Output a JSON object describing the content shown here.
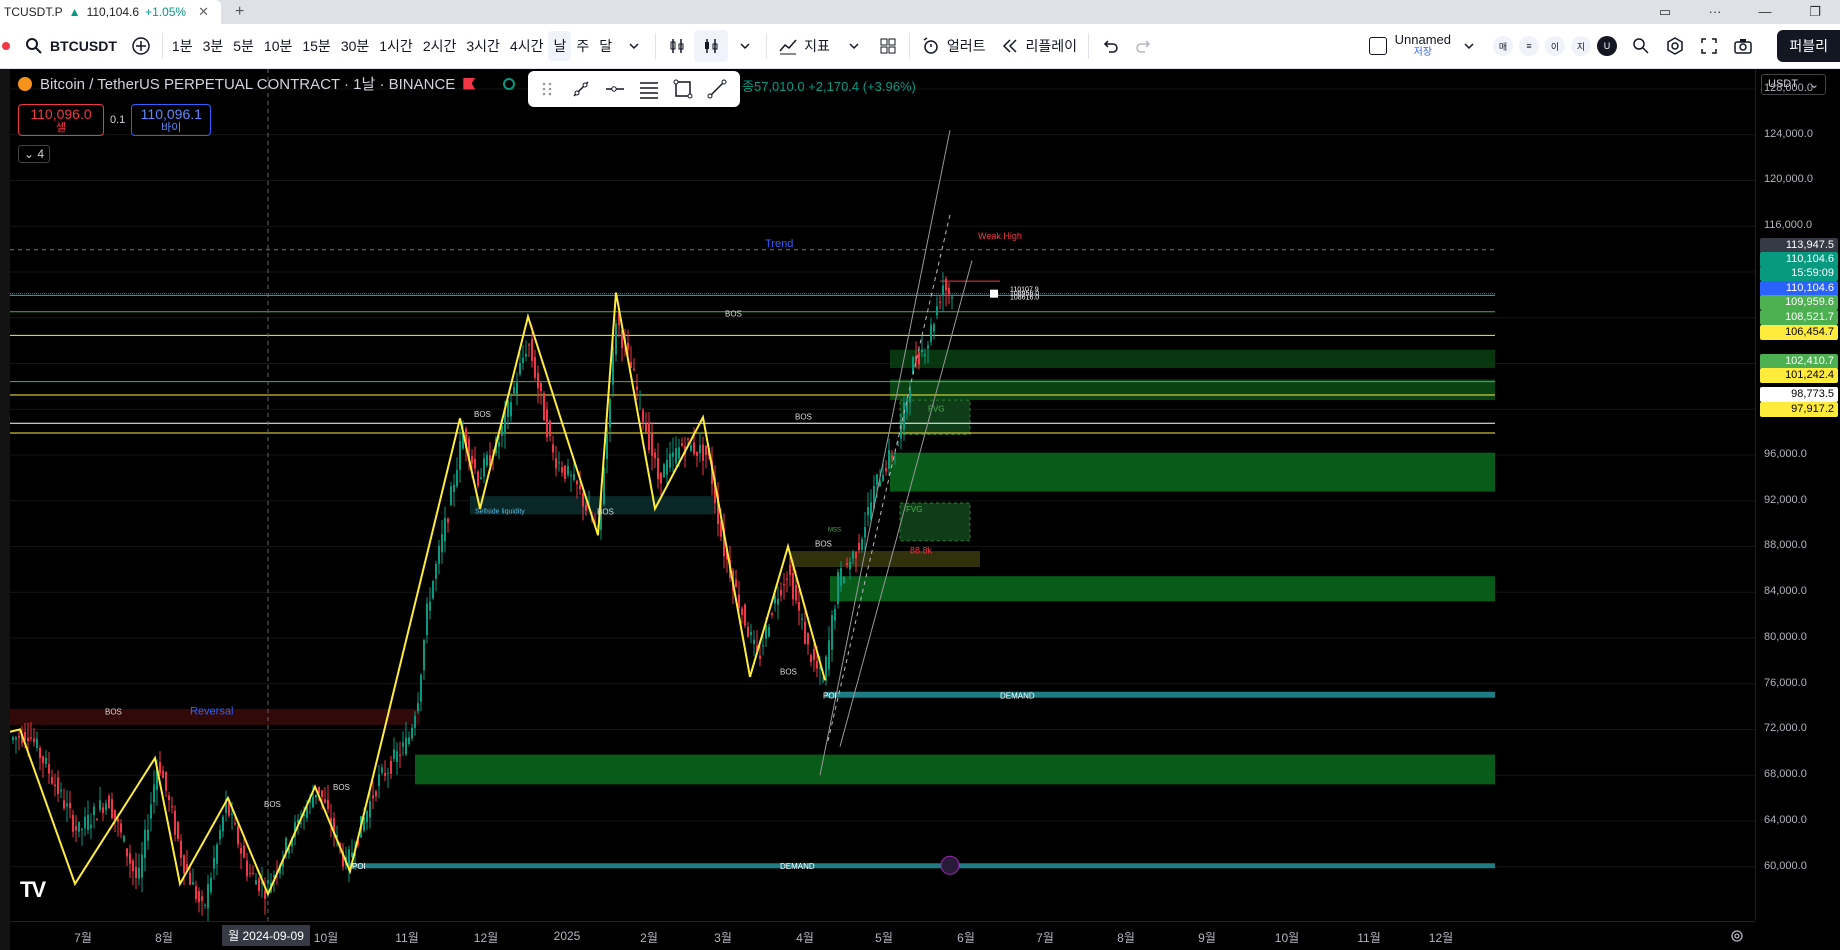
{
  "browser": {
    "tab_title": "TCUSDT.P",
    "tab_price": "110,104.6",
    "tab_change": "+1.05%",
    "tab_arrow": "▲"
  },
  "toolbar": {
    "symbol": "BTCUSDT",
    "timeframes": [
      "1분",
      "3분",
      "5분",
      "10분",
      "15분",
      "30분",
      "1시간",
      "2시간",
      "3시간",
      "4시간",
      "날",
      "주",
      "달"
    ],
    "active_timeframe": "날",
    "indicators_label": "지표",
    "alert_label": "얼러트",
    "replay_label": "리플레이",
    "layout_name": "Unnamed",
    "layout_status": "저장",
    "small_buttons": [
      "매",
      "≡",
      "이",
      "지",
      "U"
    ],
    "publish_label": "퍼블리"
  },
  "legend": {
    "title": "Bitcoin / TetherUS PERPETUAL CONTRACT · 1날 · BINANCE",
    "ohlc_tail": "종57,010.0  +2,170.4 (+3.96%)",
    "sell_price": "110,096.0",
    "sell_label": "셀",
    "spread": "0.1",
    "buy_price": "110,096.1",
    "buy_label": "바이",
    "collapse_count": "4"
  },
  "price_axis": {
    "currency": "USDT",
    "ticks": [
      "128,000.0",
      "124,000.0",
      "120,000.0",
      "116,000.0",
      "104,000.0",
      "100,000.0",
      "96,000.0",
      "92,000.0",
      "88,000.0",
      "84,000.0",
      "80,000.0",
      "76,000.0",
      "72,000.0",
      "68,000.0",
      "64,000.0",
      "60,000.0"
    ],
    "crosshair_price": "113,947.5",
    "labels": [
      {
        "text": "110,104.6",
        "bg": "#089981",
        "fg": "#ffffff"
      },
      {
        "text": "15:59:09",
        "bg": "#089981",
        "fg": "#ffffff"
      },
      {
        "text": "110,104.6",
        "bg": "#2962ff",
        "fg": "#ffffff"
      },
      {
        "text": "109,959.6",
        "bg": "#4caf50",
        "fg": "#ffffff"
      },
      {
        "text": "108,521.7",
        "bg": "#4caf50",
        "fg": "#ffffff"
      },
      {
        "text": "106,454.7",
        "bg": "#ffeb3b",
        "fg": "#000000"
      },
      {
        "text": "102,410.7",
        "bg": "#4caf50",
        "fg": "#ffffff"
      },
      {
        "text": "101,242.4",
        "bg": "#ffeb3b",
        "fg": "#000000"
      },
      {
        "text": "98,773.5",
        "bg": "#ffffff",
        "fg": "#000000"
      },
      {
        "text": "97,917.2",
        "bg": "#ffeb3b",
        "fg": "#000000"
      }
    ]
  },
  "time_axis": {
    "labels": [
      "7월",
      "8월",
      "2024-09-09",
      "10월",
      "11월",
      "12월",
      "2025",
      "2월",
      "3월",
      "4월",
      "5월",
      "6월",
      "7월",
      "8월",
      "9월",
      "10월",
      "11월",
      "12월"
    ],
    "highlight_prefix": "월"
  },
  "annotations": {
    "trend": "Trend",
    "reversal": "Reversal",
    "weak_high": "Weak High",
    "bos": "BOS",
    "fvg": "FVG",
    "demand": "DEMAND",
    "poi": "POI",
    "sellside": "Sellside liquidity",
    "price_88": "88.8k",
    "stacked_levels": [
      "110107.9",
      "108956.0",
      "108616.0"
    ],
    "mss": "MSS"
  },
  "colors": {
    "up": "#089981",
    "down": "#f23645",
    "zigzag": "#ffeb3b",
    "zone": "#0b6b1e"
  }
}
